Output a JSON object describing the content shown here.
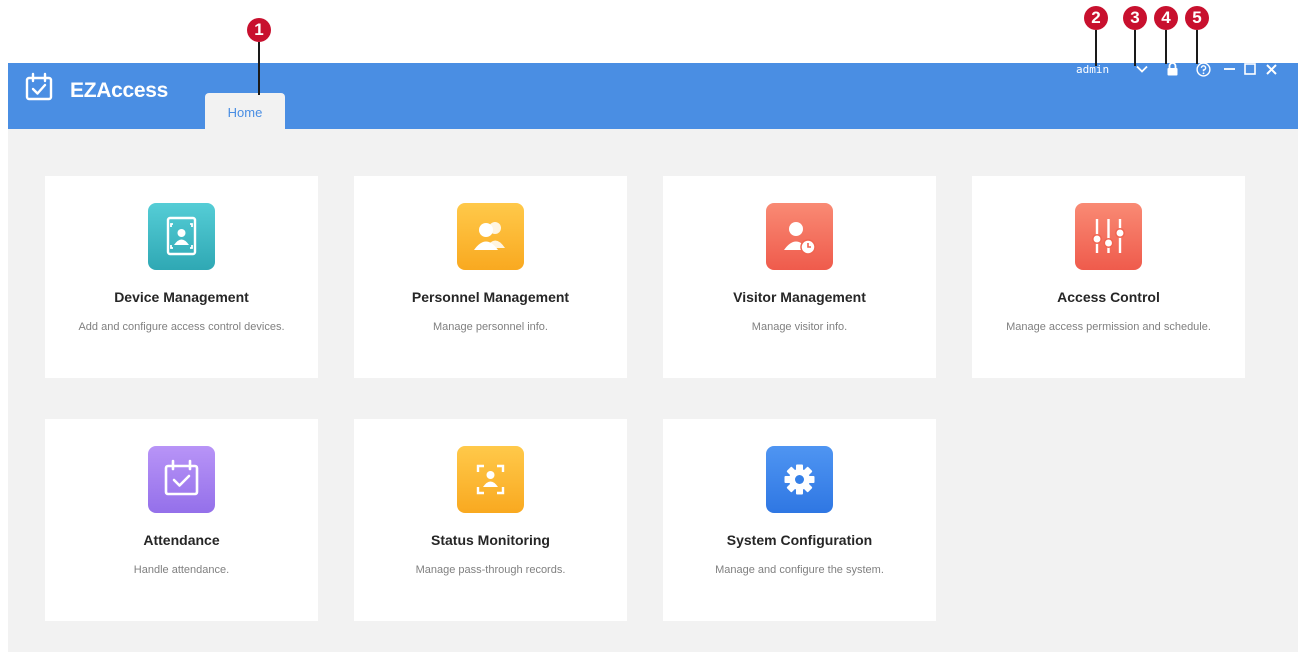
{
  "callouts": [
    "1",
    "2",
    "3",
    "4",
    "5"
  ],
  "app": {
    "name": "EZAccess"
  },
  "tabs": [
    {
      "label": "Home"
    }
  ],
  "header": {
    "user": "admin"
  },
  "cards": [
    {
      "title": "Device Management",
      "desc": "Add and configure access control devices."
    },
    {
      "title": "Personnel Management",
      "desc": "Manage personnel info."
    },
    {
      "title": "Visitor Management",
      "desc": "Manage visitor info."
    },
    {
      "title": "Access Control",
      "desc": "Manage access permission and schedule."
    },
    {
      "title": "Attendance",
      "desc": "Handle attendance."
    },
    {
      "title": "Status Monitoring",
      "desc": "Manage pass-through records."
    },
    {
      "title": "System Configuration",
      "desc": "Manage and configure the system."
    }
  ],
  "icons": {
    "logo": "calendar-check-icon",
    "dropdown": "chevron-down-icon",
    "lock": "lock-icon",
    "help": "help-icon",
    "minimize": "minimize-icon",
    "maximize": "maximize-icon",
    "close": "close-icon"
  },
  "colors": {
    "brand": "#4a8ee3",
    "callout": "#c8102e",
    "device": "#3db8c2",
    "personnel": "#fbb730",
    "visitor": "#f4705c",
    "access": "#f4705c",
    "attendance": "#a27cf0",
    "status": "#fbb730",
    "system": "#3b84ec"
  }
}
